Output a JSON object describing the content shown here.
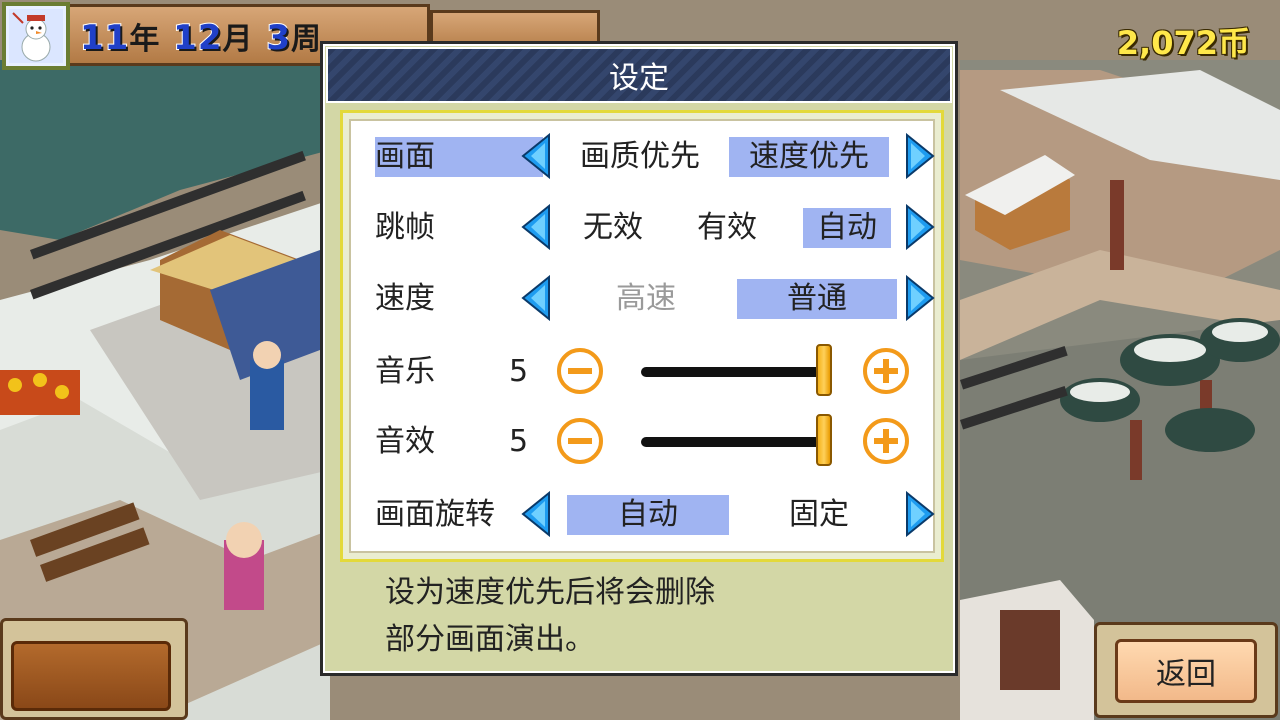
{
  "hud": {
    "year": "11",
    "year_unit": "年",
    "month": "12",
    "month_unit": "月",
    "week": "3",
    "week_unit": "周",
    "coins": "2,072币"
  },
  "dialog": {
    "title": "设定",
    "rows": {
      "graphics": {
        "label": "画面",
        "options": [
          "画质优先",
          "速度优先"
        ],
        "selected": "速度优先"
      },
      "frameskip": {
        "label": "跳帧",
        "options": [
          "无效",
          "有效",
          "自动"
        ],
        "selected": "自动"
      },
      "speed": {
        "label": "速度",
        "options": [
          "高速",
          "普通"
        ],
        "selected": "普通",
        "disabled": "高速"
      },
      "music": {
        "label": "音乐",
        "value": "5"
      },
      "sfx": {
        "label": "音效",
        "value": "5"
      },
      "rotation": {
        "label": "画面旋转",
        "options": [
          "自动",
          "固定"
        ],
        "selected": "自动"
      }
    },
    "description_line1": "设为速度优先后将会删除",
    "description_line2": "部分画面演出。"
  },
  "back_button": {
    "label": "返回"
  },
  "colors": {
    "highlight": "#a0b4f2",
    "arrow": "#1e9cf0",
    "volume_button": "#f39a1a",
    "slider_knob": "#f5b21a"
  },
  "icons": [
    "snowman-avatar-icon",
    "arrow-left-icon",
    "arrow-right-icon",
    "minus-circle-icon",
    "plus-circle-icon"
  ]
}
